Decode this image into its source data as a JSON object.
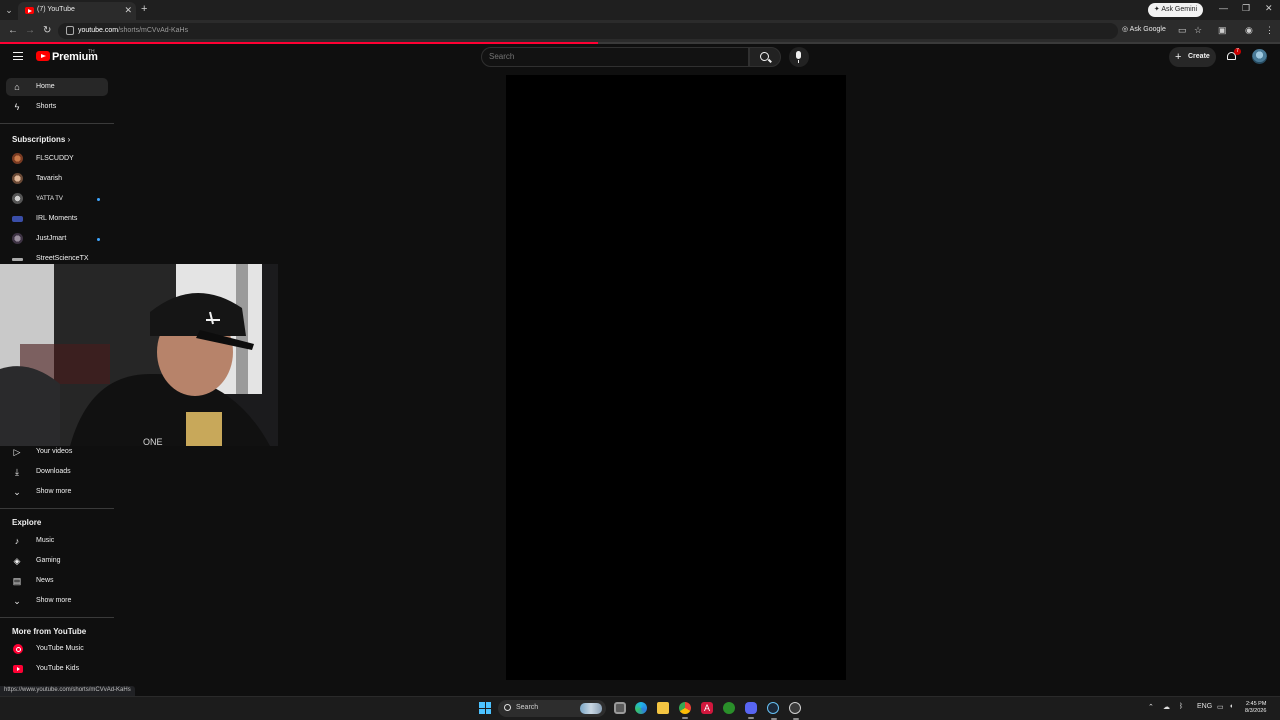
{
  "browser": {
    "tab_title": "(7) YouTube",
    "tab_close": "✕",
    "new_tab": "+",
    "gemini_label": "Ask Gemini",
    "url_host": "youtube.com",
    "url_path": "/shorts/mCVvAd-KaHs",
    "ask_google_label": "Ask Google",
    "status_url": "https://www.youtube.com/shorts/mCVvAd-KaHs",
    "progress_fraction": 0.467
  },
  "header": {
    "brand": "Premium",
    "region": "TH",
    "search_placeholder": "Search",
    "create_label": "Create",
    "notification_count": "7"
  },
  "sidebar": {
    "main": [
      {
        "label": "Home",
        "active": true
      },
      {
        "label": "Shorts",
        "active": false
      }
    ],
    "subscriptions_title": "Subscriptions",
    "subscriptions": [
      {
        "label": "FLSCUDDY",
        "live_dot": false
      },
      {
        "label": "Tavarish",
        "live_dot": false
      },
      {
        "label": "YATTA TV",
        "live_dot": true
      },
      {
        "label": "IRL Moments",
        "live_dot": false
      },
      {
        "label": "JustJmart",
        "live_dot": true
      },
      {
        "label": "StreetScienceTX",
        "live_dot": false
      }
    ],
    "you": [
      {
        "label": "Your videos"
      },
      {
        "label": "Downloads"
      },
      {
        "label": "Show more"
      }
    ],
    "explore_title": "Explore",
    "explore": [
      {
        "label": "Music"
      },
      {
        "label": "Gaming"
      },
      {
        "label": "News"
      },
      {
        "label": "Show more"
      }
    ],
    "more_title": "More from YouTube",
    "more": [
      {
        "label": "YouTube Music"
      },
      {
        "label": "YouTube Kids"
      }
    ]
  },
  "taskbar": {
    "search_placeholder": "Search",
    "language": "ENG",
    "time": "2:45 PM",
    "date": "8/3/2026"
  },
  "colors": {
    "accent": "#ff0033",
    "background": "#0f0f0f",
    "sidebar_active": "#272727"
  }
}
